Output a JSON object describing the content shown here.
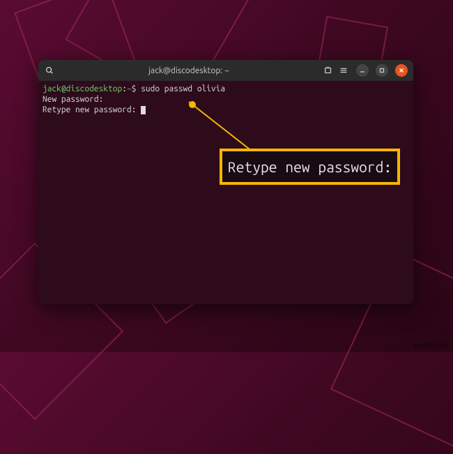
{
  "window": {
    "title": "jack@discodesktop: ~"
  },
  "terminal": {
    "prompt_user_host": "jack@discodesktop",
    "prompt_colon": ":",
    "prompt_path": "~",
    "prompt_dollar": "$",
    "command": "sudo passwd olivia",
    "line2": "New password:",
    "line3": "Retype new password:"
  },
  "callout": {
    "text": "Retype new password:"
  },
  "watermark": "wsxdn.com"
}
